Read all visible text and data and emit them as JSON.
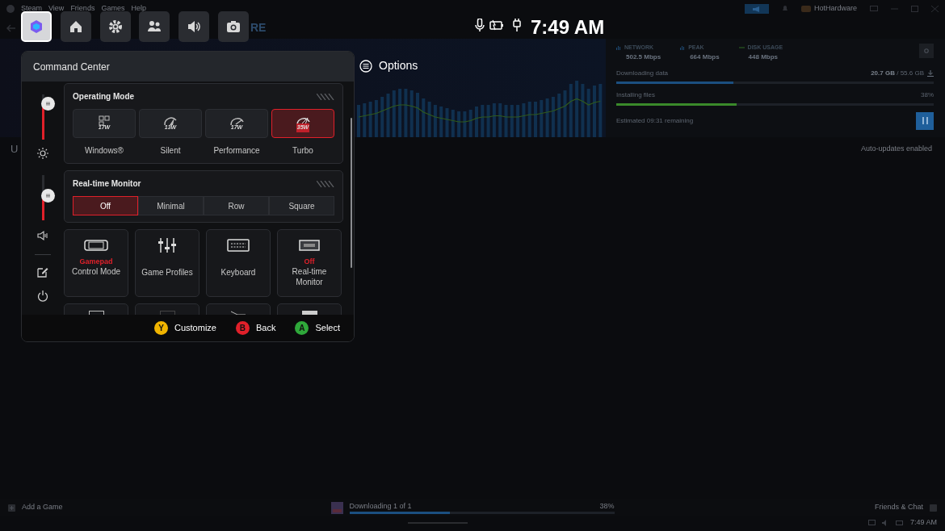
{
  "steam_menu": [
    "Steam",
    "View",
    "Friends",
    "Games",
    "Help"
  ],
  "account": {
    "name": "HotHardware"
  },
  "download_stats": [
    {
      "kind": "bars",
      "label": "NETWORK",
      "value": "502.5 Mbps"
    },
    {
      "kind": "bars",
      "label": "PEAK",
      "value": "664 Mbps"
    },
    {
      "kind": "line",
      "label": "DISK USAGE",
      "value": "448 Mbps"
    }
  ],
  "nav_fragment": "RE",
  "downloading": {
    "label": "Downloading data",
    "done": "20.7 GB",
    "total": "/ 55.6 GB",
    "level": 0.37
  },
  "installing": {
    "label": "Installing files",
    "percent": "38%",
    "level": 0.38
  },
  "estimate": "Estimated 09:31 remaining",
  "section_heading": "U",
  "auto_updates": "Auto-updates enabled",
  "bottom_bar": {
    "add_game": "Add a Game",
    "download_status": "Downloading 1 of 1",
    "percent": "38%",
    "level": 0.38,
    "friends": "Friends & Chat"
  },
  "taskbar": {
    "time": "7:49 AM"
  },
  "quick_buttons": [
    {
      "kind": "armoury",
      "selected": true
    },
    {
      "kind": "home",
      "selected": false
    },
    {
      "kind": "settings",
      "selected": false
    },
    {
      "kind": "people",
      "selected": false
    },
    {
      "kind": "volume",
      "selected": false
    },
    {
      "kind": "camera",
      "selected": false
    }
  ],
  "status_time": "7:49 AM",
  "options": "Options",
  "command_center": {
    "title": "Command Center",
    "sliders": [
      {
        "kind": "brightness",
        "level": 0.8
      },
      {
        "kind": "volume",
        "level": 0.55
      }
    ],
    "operating_mode": {
      "title": "Operating Mode",
      "modes": [
        {
          "kind": "windows",
          "watts": "17W",
          "label": "Windows®",
          "selected": false
        },
        {
          "kind": "silent",
          "watts": "13W",
          "label": "Silent",
          "selected": false
        },
        {
          "kind": "performance",
          "watts": "17W",
          "label": "Performance",
          "selected": false
        },
        {
          "kind": "turbo",
          "watts": "35W",
          "label": "Turbo",
          "selected": true
        }
      ]
    },
    "monitor": {
      "title": "Real-time Monitor",
      "options": [
        {
          "label": "Off",
          "selected": true
        },
        {
          "label": "Minimal",
          "selected": false
        },
        {
          "label": "Row",
          "selected": false
        },
        {
          "label": "Square",
          "selected": false
        }
      ]
    },
    "tiles": [
      {
        "kind": "gamepad",
        "status": "Gamepad",
        "label": "Control Mode"
      },
      {
        "kind": "sliders",
        "label": "Game Profiles"
      },
      {
        "kind": "keyboard",
        "label": "Keyboard"
      },
      {
        "kind": "monitor",
        "status": "Off",
        "label": "Real-time Monitor"
      }
    ],
    "more_tiles": [
      {
        "kind": "display"
      },
      {
        "kind": "blank"
      },
      {
        "kind": "fan"
      },
      {
        "kind": "screen"
      }
    ],
    "footer": [
      {
        "key": "Y",
        "label": "Customize",
        "color": "#f0b400"
      },
      {
        "key": "B",
        "label": "Back",
        "color": "#e0202a"
      },
      {
        "key": "A",
        "label": "Select",
        "color": "#2fa83a"
      }
    ]
  }
}
